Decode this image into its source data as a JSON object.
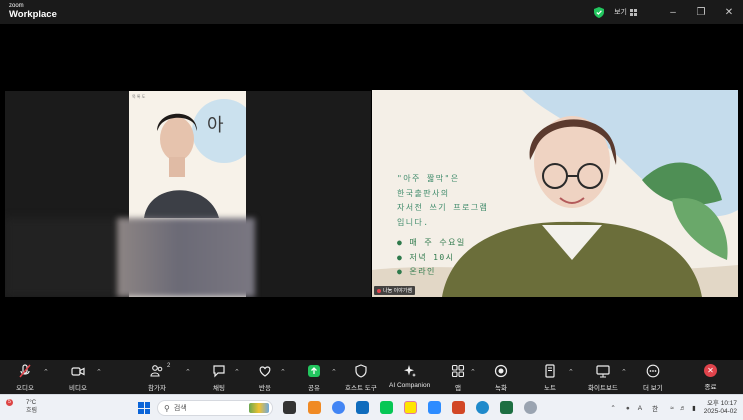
{
  "titlebar": {
    "brand_small": "zoom",
    "brand_name": "Workplace",
    "view_label": "보기"
  },
  "slide_left_header": "목 록 도",
  "slide": {
    "lines": [
      "\"아주 짧막\"은",
      "한국출판사의",
      "자서전 쓰기 프로그램",
      "입니다."
    ],
    "bullets": [
      "● 매 주 수요일",
      "● 저녁 10시",
      "● 온라인"
    ]
  },
  "participant_tag": "나눔 이야기쌤",
  "toolbar": {
    "audio": "오디오",
    "video": "비디오",
    "participants": "참가자",
    "participants_count": "2",
    "chat": "채팅",
    "react": "반응",
    "share": "공유",
    "host_tools": "호스트 도구",
    "ai": "AI Companion",
    "apps": "앱",
    "record": "녹화",
    "notes": "노트",
    "whiteboard": "화이트보드",
    "more": "더 보기",
    "end": "종료"
  },
  "taskbar": {
    "weather_temp": "7°C",
    "weather_desc": "흐림",
    "weather_badge": "5",
    "search_placeholder": "검색",
    "ime_a": "A",
    "ime_han": "한",
    "time": "오후 10:17",
    "date": "2025-04-02"
  },
  "colors": {
    "accent_green": "#3f8b6b",
    "end_red": "#e0434b",
    "share_green": "#22c55e"
  }
}
